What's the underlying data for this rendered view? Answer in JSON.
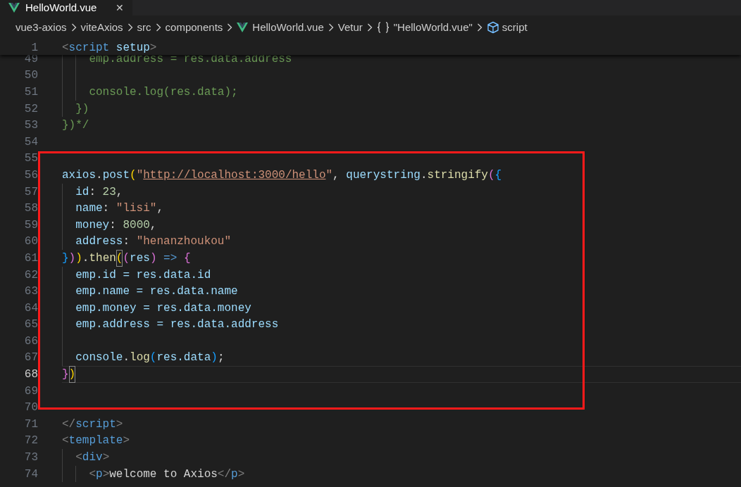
{
  "tabs": [
    {
      "label": "HelloWorld.vue",
      "close": "✕",
      "selected": true
    }
  ],
  "breadcrumbs": [
    {
      "label": "vue3-axios"
    },
    {
      "label": "viteAxios"
    },
    {
      "label": "src"
    },
    {
      "label": "components"
    },
    {
      "label": "HelloWorld.vue",
      "kind": "vue"
    },
    {
      "label": "Vetur"
    },
    {
      "label": "\"HelloWorld.vue\"",
      "kind": "object"
    },
    {
      "label": "script",
      "kind": "module"
    }
  ],
  "sticky_line": {
    "number": "1",
    "tokens": [
      {
        "t": "<",
        "kind": "punct"
      },
      {
        "t": "script",
        "kind": "tag"
      },
      {
        "t": " setup",
        "kind": "attr"
      },
      {
        "t": ">",
        "kind": "punct"
      }
    ]
  },
  "sections": [
    {
      "highlighted": false,
      "lines": [
        {
          "number": "49",
          "current": false,
          "tokens": [
            {
              "t": "    emp.address = res.data.address",
              "kind": "comment"
            }
          ]
        },
        {
          "number": "50",
          "current": false
        },
        {
          "number": "51",
          "current": false,
          "tokens": [
            {
              "t": "    console.log(res.data);",
              "kind": "comment"
            }
          ]
        },
        {
          "number": "52",
          "current": false,
          "tokens": [
            {
              "t": "  })",
              "kind": "comment"
            }
          ]
        },
        {
          "number": "53",
          "current": false,
          "tokens": [
            {
              "t": "})*/",
              "kind": "comment"
            }
          ]
        },
        {
          "number": "54",
          "current": false
        }
      ]
    },
    {
      "highlighted": true,
      "lines": [
        {
          "number": "55",
          "current": false
        },
        {
          "number": "56",
          "current": false,
          "tokens": [
            {
              "t": "axios",
              "kind": "var"
            },
            {
              "t": ".",
              "kind": "plain"
            },
            {
              "t": "post",
              "kind": "var"
            },
            {
              "t": "(",
              "kind": "b1"
            },
            {
              "t": "\"",
              "kind": "string"
            },
            {
              "t": "http://localhost:3000/hello",
              "kind": "link"
            },
            {
              "t": "\"",
              "kind": "string"
            },
            {
              "t": ", ",
              "kind": "plain"
            },
            {
              "t": "querystring",
              "kind": "var"
            },
            {
              "t": ".",
              "kind": "plain"
            },
            {
              "t": "stringify",
              "kind": "func"
            },
            {
              "t": "(",
              "kind": "b2"
            },
            {
              "t": "{",
              "kind": "b3"
            }
          ]
        },
        {
          "number": "57",
          "current": false,
          "tokens": [
            {
              "t": "  id",
              "kind": "var"
            },
            {
              "t": ": ",
              "kind": "plain"
            },
            {
              "t": "23",
              "kind": "number"
            },
            {
              "t": ",",
              "kind": "plain"
            }
          ]
        },
        {
          "number": "58",
          "current": false,
          "tokens": [
            {
              "t": "  name",
              "kind": "var"
            },
            {
              "t": ": ",
              "kind": "plain"
            },
            {
              "t": "\"lisi\"",
              "kind": "string"
            },
            {
              "t": ",",
              "kind": "plain"
            }
          ]
        },
        {
          "number": "59",
          "current": false,
          "tokens": [
            {
              "t": "  money",
              "kind": "var"
            },
            {
              "t": ": ",
              "kind": "plain"
            },
            {
              "t": "8000",
              "kind": "number"
            },
            {
              "t": ",",
              "kind": "plain"
            }
          ]
        },
        {
          "number": "60",
          "current": false,
          "tokens": [
            {
              "t": "  address",
              "kind": "var"
            },
            {
              "t": ": ",
              "kind": "plain"
            },
            {
              "t": "\"henanzhoukou\"",
              "kind": "string"
            }
          ]
        },
        {
          "number": "61",
          "current": false,
          "tokens": [
            {
              "t": "}",
              "kind": "b3"
            },
            {
              "t": ")",
              "kind": "b2"
            },
            {
              "t": ")",
              "kind": "b1"
            },
            {
              "t": ".",
              "kind": "plain"
            },
            {
              "t": "then",
              "kind": "func"
            },
            {
              "t": "(",
              "kind": "b1-match"
            },
            {
              "t": "(",
              "kind": "b2"
            },
            {
              "t": "res",
              "kind": "var"
            },
            {
              "t": ")",
              "kind": "b2"
            },
            {
              "t": " => ",
              "kind": "keyword"
            },
            {
              "t": "{",
              "kind": "b2"
            }
          ]
        },
        {
          "number": "62",
          "current": false,
          "tokens": [
            {
              "t": "  emp.id = res.data.id",
              "kind": "var"
            }
          ]
        },
        {
          "number": "63",
          "current": false,
          "tokens": [
            {
              "t": "  emp.name = res.data.name",
              "kind": "var"
            }
          ]
        },
        {
          "number": "64",
          "current": false,
          "tokens": [
            {
              "t": "  emp.money = res.data.money",
              "kind": "var"
            }
          ]
        },
        {
          "number": "65",
          "current": false,
          "tokens": [
            {
              "t": "  emp.address = res.data.address",
              "kind": "var"
            }
          ]
        },
        {
          "number": "66",
          "current": false
        },
        {
          "number": "67",
          "current": false,
          "tokens": [
            {
              "t": "  console",
              "kind": "var"
            },
            {
              "t": ".",
              "kind": "plain"
            },
            {
              "t": "log",
              "kind": "func"
            },
            {
              "t": "(",
              "kind": "b3"
            },
            {
              "t": "res.data",
              "kind": "var"
            },
            {
              "t": ")",
              "kind": "b3"
            },
            {
              "t": ";",
              "kind": "plain"
            }
          ]
        },
        {
          "number": "68",
          "current": true,
          "tokens": [
            {
              "t": "}",
              "kind": "b2"
            },
            {
              "t": ")",
              "kind": "b1-match"
            }
          ]
        },
        {
          "number": "69",
          "current": false
        },
        {
          "number": "70",
          "current": false
        }
      ]
    },
    {
      "highlighted": false,
      "lines": [
        {
          "number": "71",
          "current": false,
          "tokens": [
            {
              "t": "</",
              "kind": "punct"
            },
            {
              "t": "script",
              "kind": "tag"
            },
            {
              "t": ">",
              "kind": "punct"
            }
          ]
        },
        {
          "number": "72",
          "current": false,
          "tokens": [
            {
              "t": "<",
              "kind": "punct"
            },
            {
              "t": "template",
              "kind": "tag"
            },
            {
              "t": ">",
              "kind": "punct"
            }
          ]
        },
        {
          "number": "73",
          "current": false,
          "tokens": [
            {
              "t": "  <",
              "kind": "punct"
            },
            {
              "t": "div",
              "kind": "tag"
            },
            {
              "t": ">",
              "kind": "punct"
            }
          ]
        },
        {
          "number": "74",
          "current": false,
          "tokens": [
            {
              "t": "    <",
              "kind": "punct"
            },
            {
              "t": "p",
              "kind": "tag"
            },
            {
              "t": ">",
              "kind": "punct"
            },
            {
              "t": "welcome to Axios",
              "kind": "plain"
            },
            {
              "t": "</",
              "kind": "punct"
            },
            {
              "t": "p",
              "kind": "tag"
            },
            {
              "t": ">",
              "kind": "punct"
            }
          ]
        }
      ]
    }
  ]
}
